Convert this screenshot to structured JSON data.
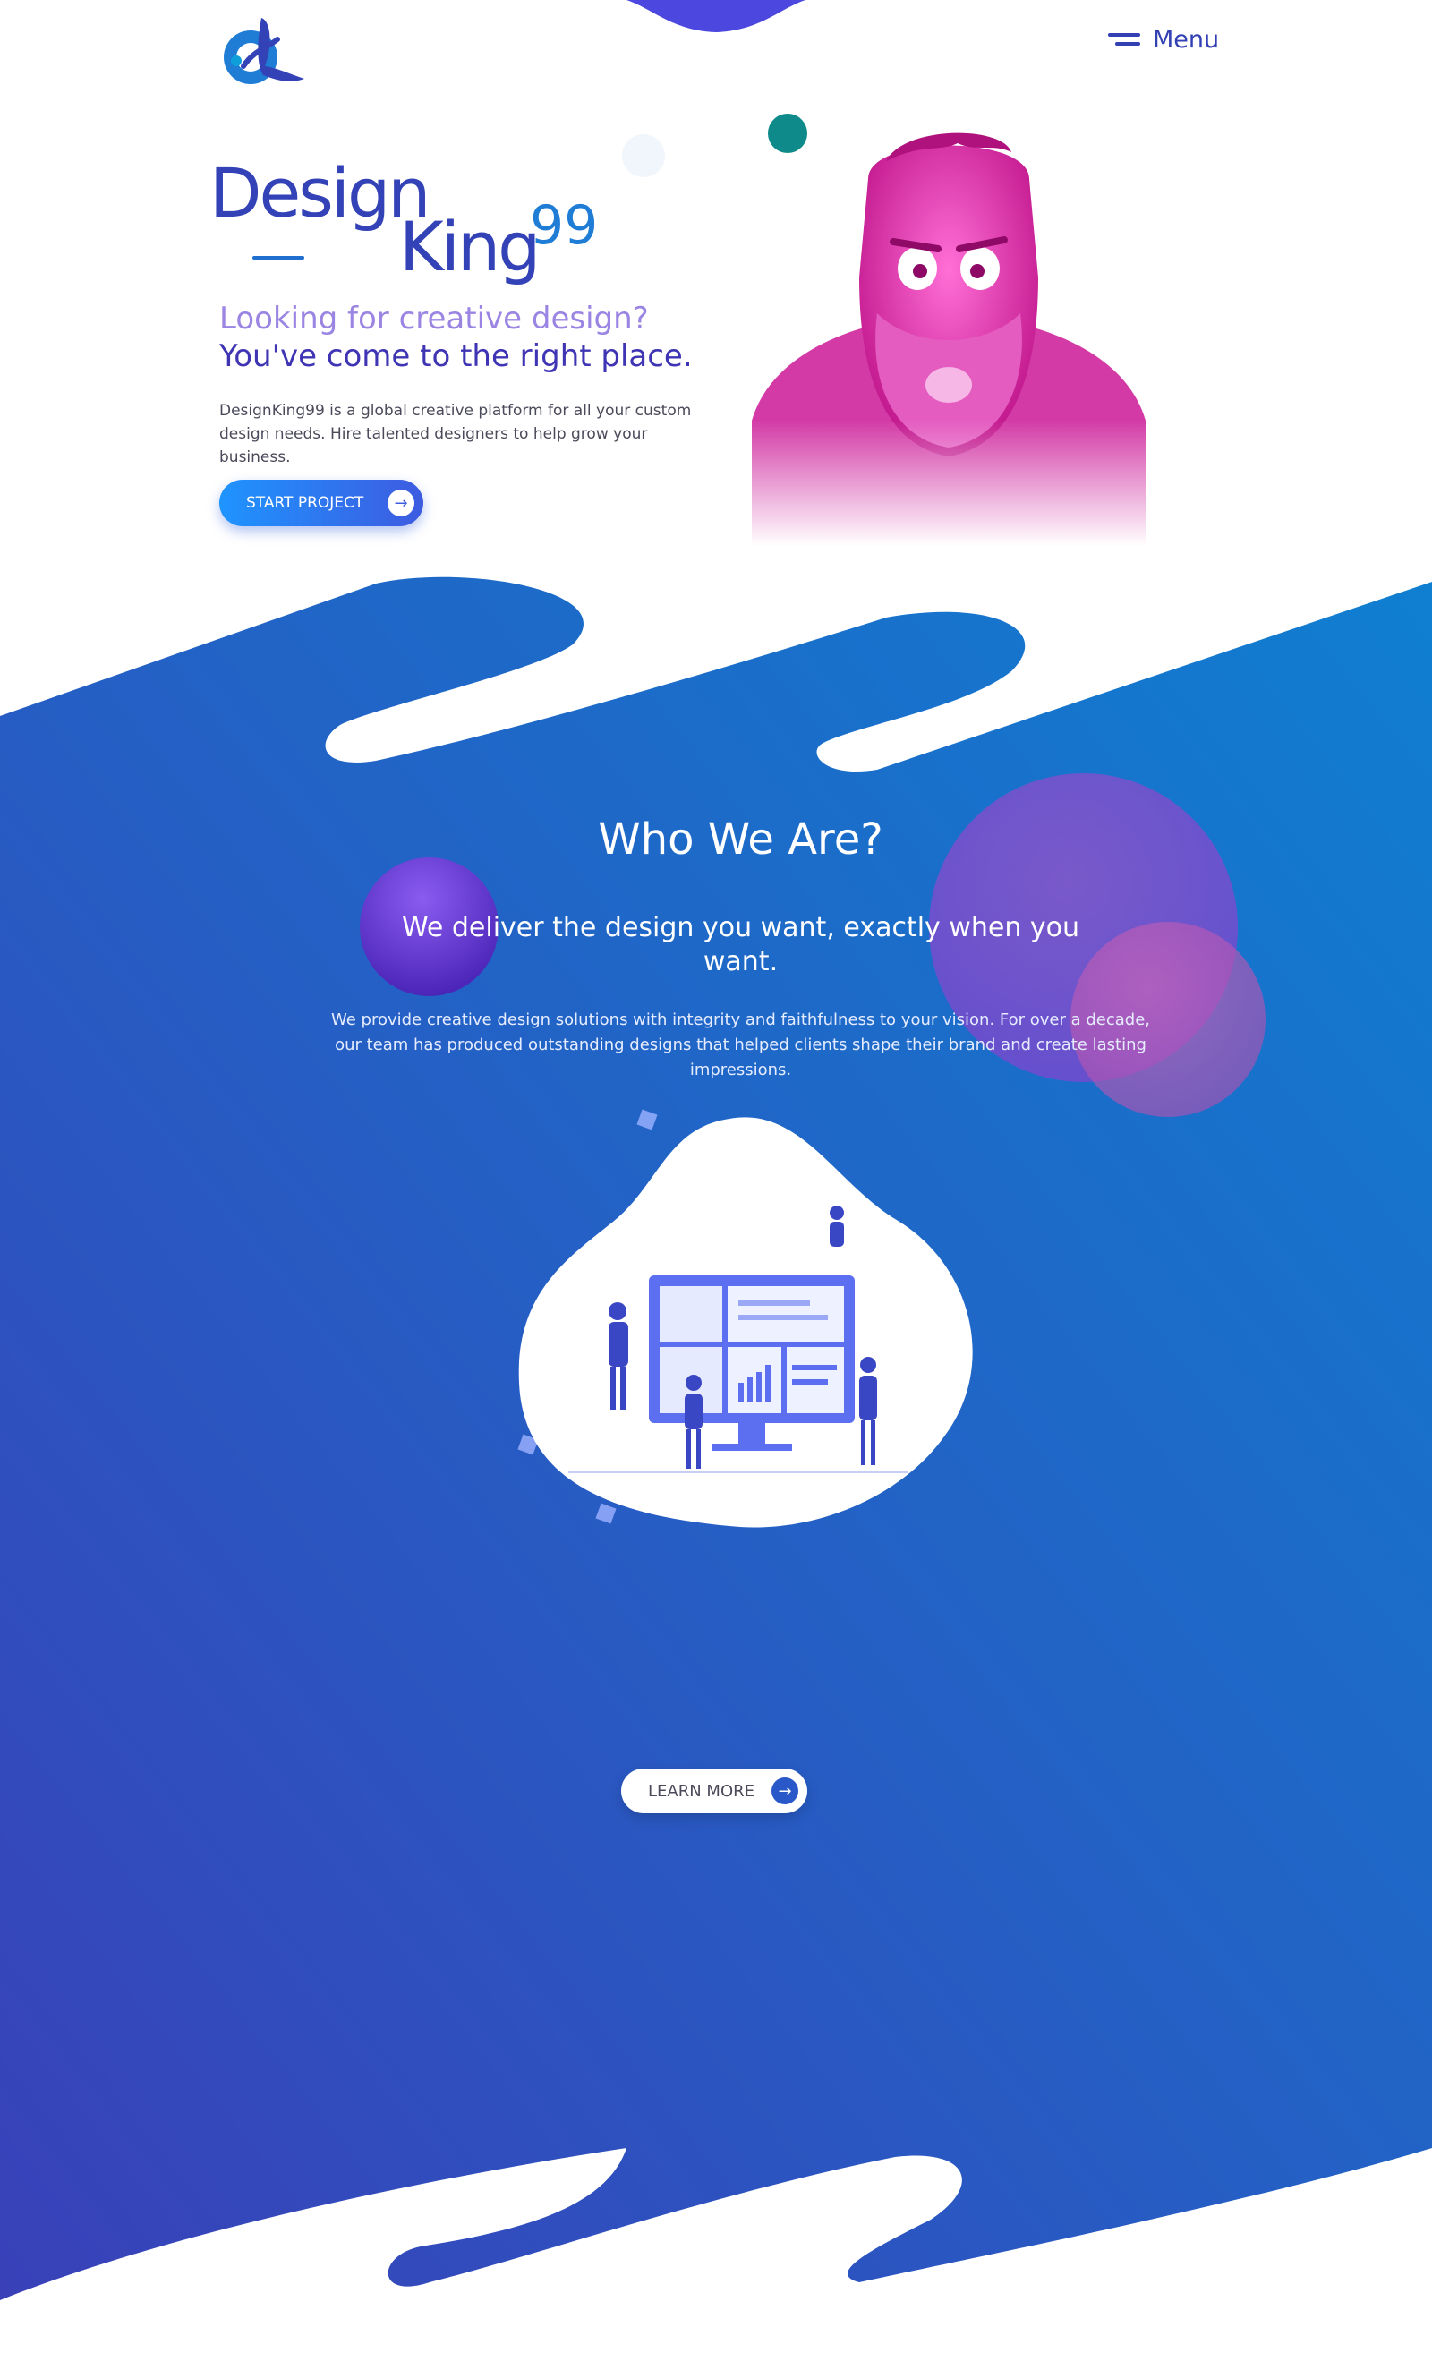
{
  "header": {
    "menu_label": "Menu"
  },
  "hero": {
    "brand_part1": "Design",
    "brand_part2": "King",
    "brand_part3": "99",
    "tagline_line1": "Looking for creative design?",
    "tagline_line2": "You've come to the right place.",
    "description": "DesignKing99 is a global creative platform for all your custom design needs. Hire talented designers to help grow your business.",
    "cta_label": "START PROJECT"
  },
  "who_we_are": {
    "title": "Who We Are?",
    "subtitle": "We deliver the design you want, exactly when you want.",
    "text": "We provide creative design solutions with integrity and faithfulness to your vision. For over a decade, our team has produced outstanding designs that helped clients shape their brand and create lasting impressions.",
    "cta_label": "LEARN MORE"
  },
  "colors": {
    "brand_blue": "#3342b6",
    "accent_blue": "#1f7dd6",
    "section_gradient_start": "#3a3fb8",
    "section_gradient_end": "#0f7fd1",
    "magenta": "#d61fa8"
  },
  "icons": [
    "logo-icon",
    "menu-icon",
    "arrow-right-icon",
    "character-illustration",
    "team-dashboard-illustration"
  ]
}
